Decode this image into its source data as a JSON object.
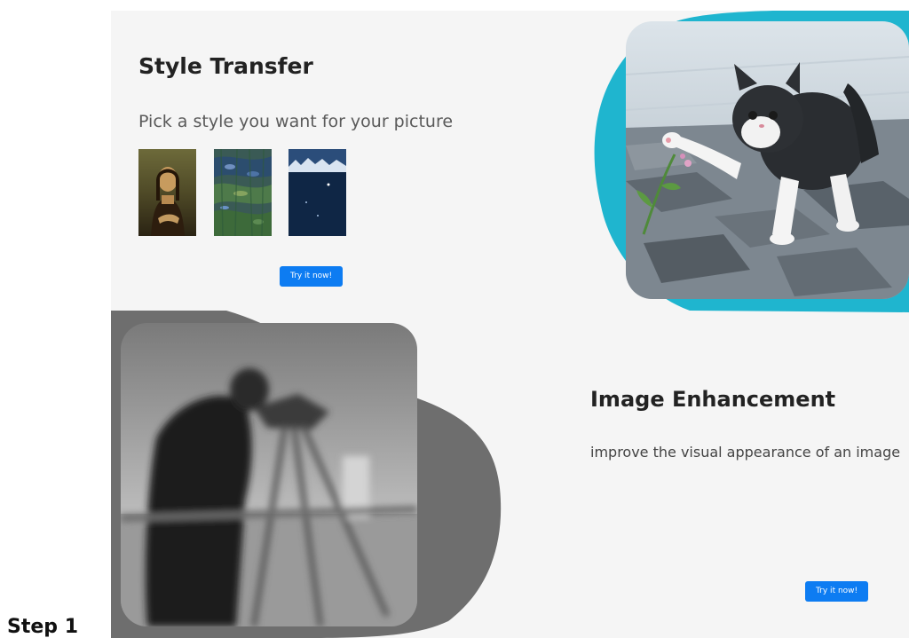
{
  "style_transfer": {
    "title": "Style Transfer",
    "subtitle": "Pick a style you want for your picture",
    "style_options": [
      {
        "name": "mona-lisa"
      },
      {
        "name": "water-lilies"
      },
      {
        "name": "night-sky"
      }
    ],
    "button_label": "Try it now!"
  },
  "image_enhancement": {
    "title": "Image Enhancement",
    "subtitle": "improve the visual appearance of an image",
    "button_label": "Try it now!"
  },
  "step_label": "Step 1",
  "colors": {
    "accent": "#0d7cf2",
    "teal_blob": "#1fb5cf",
    "grey_blob": "#6e6e6e",
    "panel_bg": "#f5f5f5"
  }
}
